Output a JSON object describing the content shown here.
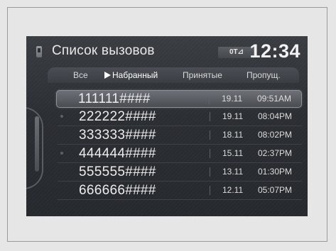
{
  "header": {
    "title": "Список вызовов",
    "status_badge": "0T⊿",
    "clock": "12:34"
  },
  "tabs": [
    {
      "label": "Все"
    },
    {
      "label": "Набранный",
      "active": true
    },
    {
      "label": "Принятые"
    },
    {
      "label": "Пропущ."
    }
  ],
  "calls": [
    {
      "number": "111111####",
      "date": "19.11",
      "time": "09:51AM",
      "selected": true
    },
    {
      "number": "222222####",
      "date": "19.11",
      "time": "08:04PM"
    },
    {
      "number": "333333####",
      "date": "18.11",
      "time": "08:02PM"
    },
    {
      "number": "444444####",
      "date": "15.11",
      "time": "02:37PM"
    },
    {
      "number": "555555####",
      "date": "13.11",
      "time": "01:30PM"
    },
    {
      "number": "666666####",
      "date": "12.11",
      "time": "05:07PM"
    }
  ],
  "icons": {
    "phone": "phone-icon",
    "active_tab": "triangle-right-icon"
  },
  "colors": {
    "screen_bg": "#2b2e32",
    "text": "#ececec",
    "highlight": "#6d7076"
  }
}
